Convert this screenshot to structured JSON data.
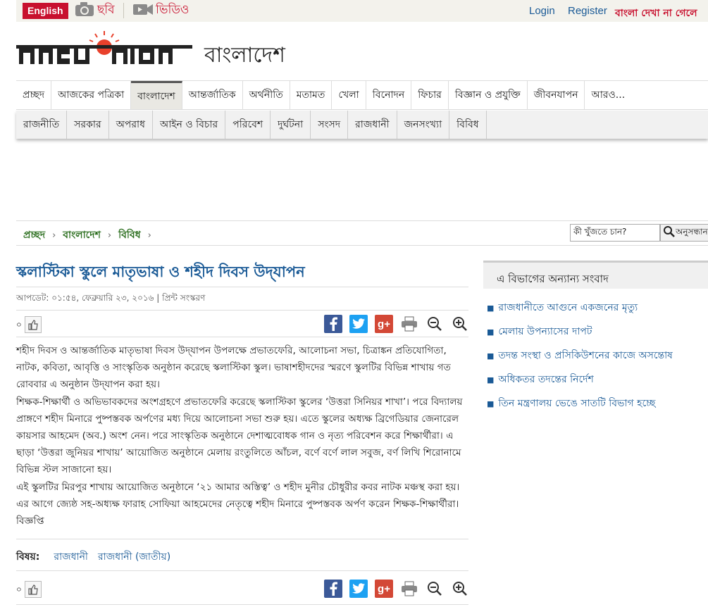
{
  "topbar": {
    "english_label": "English",
    "photo_label": "ছবি",
    "video_label": "ভিডিও",
    "login_label": "Login",
    "register_label": "Register",
    "bangla_note": "বাংলা দেখা না গেলে"
  },
  "masthead": {
    "logo_text": "প্রথম আলো",
    "section": "বাংলাদেশ"
  },
  "main_nav": [
    {
      "label": "প্রচ্ছদ"
    },
    {
      "label": "আজকের পত্রিকা"
    },
    {
      "label": "বাংলাদেশ",
      "active": true
    },
    {
      "label": "আন্তর্জাতিক"
    },
    {
      "label": "অর্থনীতি"
    },
    {
      "label": "মতামত"
    },
    {
      "label": "খেলা"
    },
    {
      "label": "বিনোদন"
    },
    {
      "label": "ফিচার"
    },
    {
      "label": "বিজ্ঞান ও প্রযুক্তি"
    },
    {
      "label": "জীবনযাপন"
    },
    {
      "label": "আরও..."
    }
  ],
  "sub_nav": [
    {
      "label": "রাজনীতি"
    },
    {
      "label": "সরকার"
    },
    {
      "label": "অপরাধ"
    },
    {
      "label": "আইন ও বিচার"
    },
    {
      "label": "পরিবেশ"
    },
    {
      "label": "দুর্ঘটনা"
    },
    {
      "label": "সংসদ"
    },
    {
      "label": "রাজধানী"
    },
    {
      "label": "জনসংখ্যা"
    },
    {
      "label": "বিবিধ"
    }
  ],
  "breadcrumb": [
    "প্রচ্ছদ",
    "বাংলাদেশ",
    "বিবিধ"
  ],
  "search": {
    "value": "কী খুঁজতে চান?",
    "button_label": "অনুসন্ধান"
  },
  "article": {
    "headline": "স্কলাস্টিকা স্কুলে মাতৃভাষা ও শহীদ দিবস উদ্‌যাপন",
    "meta": "আপডেট: ০১:৫৪, ফেব্রুয়ারি ২৩, ২০১৬ | প্রিন্ট সংস্করণ",
    "like_count": "০",
    "paragraphs": [
      "শহীদ দিবস ও আন্তর্জাতিক মাতৃভাষা দিবস উদ্‌যাপন উপলক্ষে প্রভাতফেরি, আলোচনা সভা, চিত্রাঙ্কন প্রতিযোগিতা, নাটক, কবিতা, আবৃত্তি ও সাংস্কৃতিক অনুষ্ঠান করেছে স্কলাস্টিকা স্কুল। ভাষাশহীদদের স্মরণে স্কুলটির বিভিন্ন শাখায় গত রোববার এ অনুষ্ঠান উদ্‌যাপন করা হয়।",
      "শিক্ষক-শিক্ষার্থী ও অভিভাবকদের অংশগ্রহণে প্রভাতফেরি করেছে স্কলাস্টিকা স্কুলের ‘উত্তরা সিনিয়র শাখা’। পরে বিদ্যালয় প্রাঙ্গণে শহীদ মিনারে পুষ্পস্তবক অর্পণের মধ্য দিয়ে আলোচনা সভা শুরু হয়। এতে স্কুলের অধ্যক্ষ ব্রিগেডিয়ার জেনারেল কায়সার আহমেদ (অব.) অংশ নেন। পরে সাংস্কৃতিক অনুষ্ঠানে দেশাত্মবোধক গান ও নৃত্য পরিবেশন করে শিক্ষার্থীরা। এ ছাড়া ‘উত্তরা জুনিয়র শাখায়’ আয়োজিত অনুষ্ঠানে মেলায় রংতুলিতে আঁচল, বর্ণে বর্ণে লাল সবুজ, বর্ণ লিখি শিরোনামে বিভিন্ন স্টল সাজানো হয়।",
      "এই স্কুলটির মিরপুর শাখায় আয়োজিত অনুষ্ঠানে ‘২১ আমার অস্তিত্ব’ ও শহীদ মুনীর চৌধুরীর কবর নাটক মঞ্চস্থ করা হয়। এর আগে জ্যেষ্ঠ সহ-অধ্যক্ষ ফারাহ সোফিয়া আহমেদের নেতৃত্বে শহীদ মিনারে পুষ্পস্তবক অর্পণ করেন শিক্ষক-শিক্ষার্থীরা। বিজ্ঞপ্তি"
    ],
    "topics_label": "বিষয়:",
    "topics": [
      "রাজধানী",
      "রাজধানী (জাতীয়)"
    ]
  },
  "sidebar": {
    "heading": "এ বিভাগের অন্যান্য সংবাদ",
    "items": [
      "রাজধানীতে আগুনে একজনের মৃত্যু",
      "মেলায় উপন্যাসের দাপট",
      "তদন্ত সংস্থা ও প্রসিকিউশনের কাজে অসন্তোষ",
      "অধিকতর তদন্তের নির্দেশ",
      "তিন মন্ত্রণালয় ভেঙে সাতটি বিভাগ হচ্ছে"
    ]
  },
  "colors": {
    "brand_red": "#c8102e",
    "link_blue": "#1a5a96",
    "breadcrumb_green": "#2b6e1e"
  }
}
